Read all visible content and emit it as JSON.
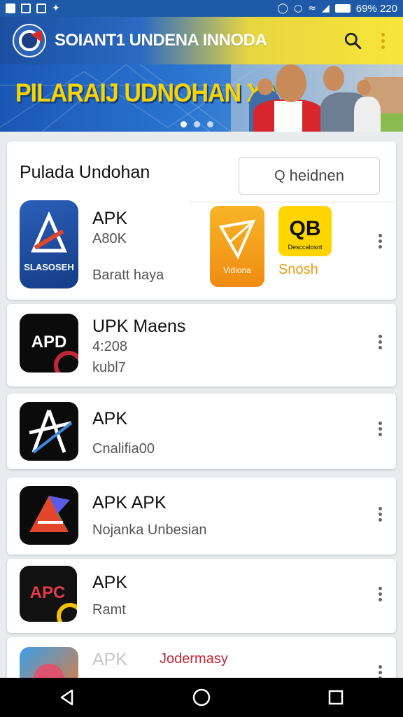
{
  "status_bar": {
    "right_text": "69% 220"
  },
  "app_bar": {
    "title": "SOIANT1 UNDENA INNODA",
    "search_icon": "search-icon",
    "menu_icon": "more-vert-icon"
  },
  "banner": {
    "headline": "PILARAIJ UDNOHAN XA",
    "slides": 3,
    "active_slide": 1
  },
  "section": {
    "title": "Pulada Undohan",
    "search_placeholder": "heidnen"
  },
  "featured": [
    {
      "name": "APK",
      "size": "A80K",
      "desc": "Baratt haya"
    },
    {
      "icon_label": "Vidiona"
    },
    {
      "icon_label": "Desccalosnt",
      "caption": "Snosh"
    }
  ],
  "items": [
    {
      "name": "UPK Maens",
      "meta": "4:208",
      "desc": "kubl7",
      "icon_text": "APD"
    },
    {
      "name": "APK",
      "desc": "Cnalifia00",
      "icon_text": "A"
    },
    {
      "name": "APK  APK",
      "desc": "Nojanka Unbesian",
      "icon_text": ""
    },
    {
      "name": "APK",
      "desc": "Ramt",
      "icon_text": "APC"
    },
    {
      "name": "APK",
      "desc": "Jodermasy",
      "icon_text": ""
    }
  ],
  "colors": {
    "status_bar": "#1e5aa8",
    "brand_blue": "#1b4fa0",
    "brand_yellow": "#f7e53a",
    "accent_red": "#c0283a"
  }
}
